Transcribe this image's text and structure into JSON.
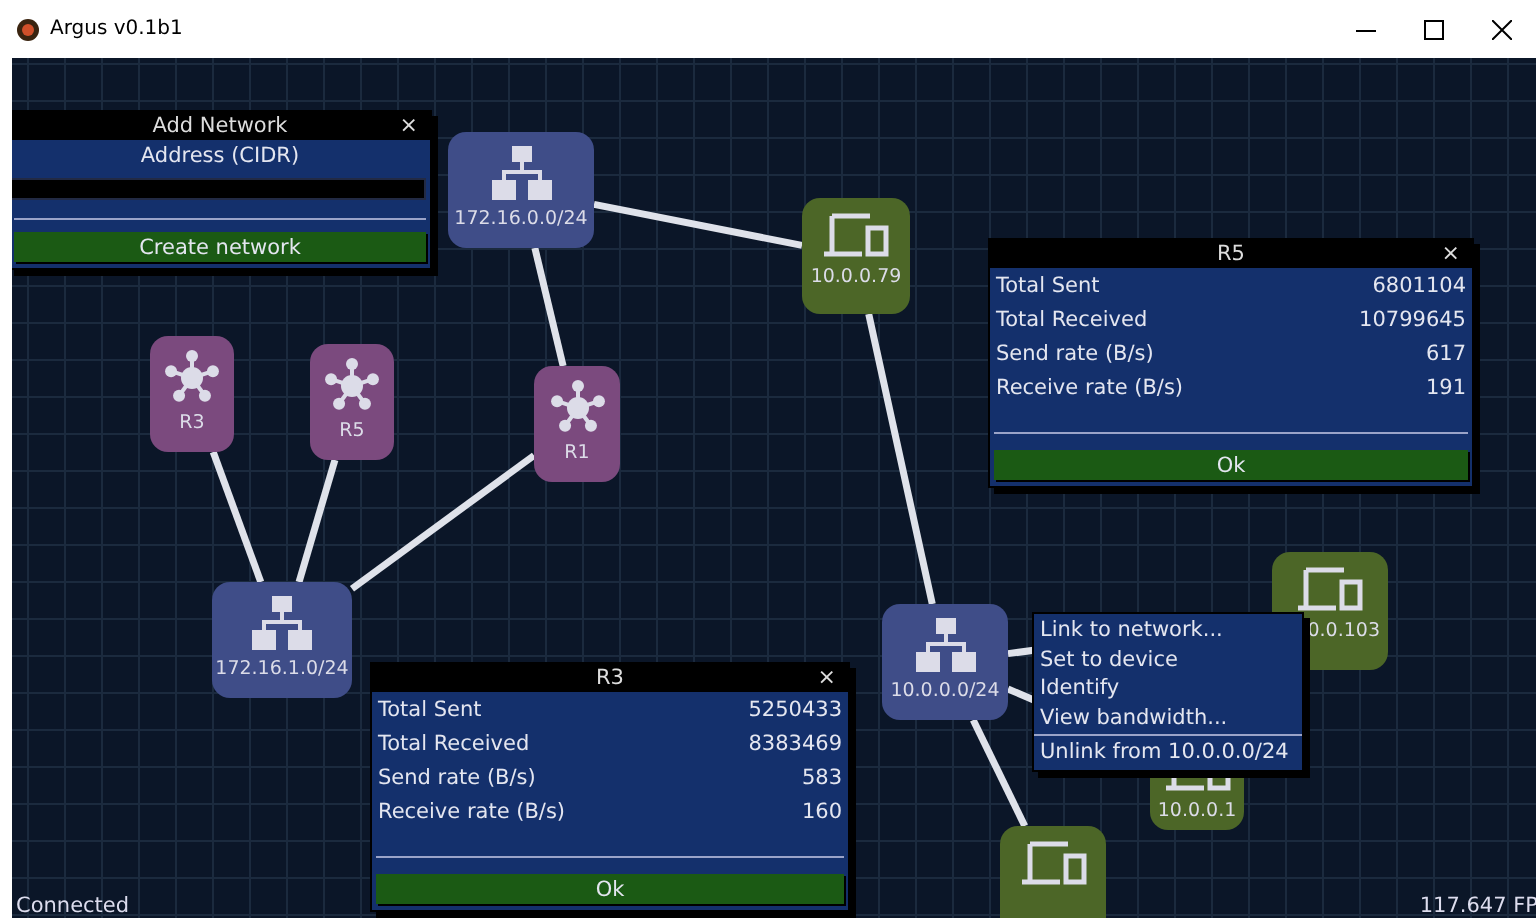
{
  "window": {
    "title": "Argus v0.1b1"
  },
  "nodes": [
    {
      "kind": "network",
      "label": "172.16.0.0/24"
    },
    {
      "kind": "device",
      "label": "10.0.0.79"
    },
    {
      "kind": "router",
      "label": "R3"
    },
    {
      "kind": "router",
      "label": "R5"
    },
    {
      "kind": "router",
      "label": "R1"
    },
    {
      "kind": "network",
      "label": "172.16.1.0/24"
    },
    {
      "kind": "network",
      "label": "10.0.0.0/24"
    },
    {
      "kind": "device",
      "label": "0.0.103"
    },
    {
      "kind": "device",
      "label": "10.0.0.1"
    },
    {
      "kind": "device"
    }
  ],
  "add_network": {
    "title": "Add Network",
    "close": "×",
    "field_label": "Address (CIDR)",
    "button": "Create network"
  },
  "dialogs": [
    {
      "title": "R5",
      "close": "×",
      "rows": [
        {
          "label": "Total Sent",
          "value": "6801104"
        },
        {
          "label": "Total Received",
          "value": "10799645"
        },
        {
          "label": "Send rate (B/s)",
          "value": "617"
        },
        {
          "label": "Receive rate (B/s)",
          "value": "191"
        }
      ],
      "button": "Ok"
    },
    {
      "title": "R3",
      "close": "×",
      "rows": [
        {
          "label": "Total Sent",
          "value": "5250433"
        },
        {
          "label": "Total Received",
          "value": "8383469"
        },
        {
          "label": "Send rate (B/s)",
          "value": "583"
        },
        {
          "label": "Receive rate (B/s)",
          "value": "160"
        }
      ],
      "button": "Ok"
    }
  ],
  "context_menu": {
    "items": [
      "Link to network...",
      "Set to device",
      "Identify",
      "View bandwidth..."
    ],
    "footer_item": "Unlink from 10.0.0.0/24"
  },
  "status_bar": {
    "connection": "Connected",
    "fps": "117.647 FP"
  }
}
